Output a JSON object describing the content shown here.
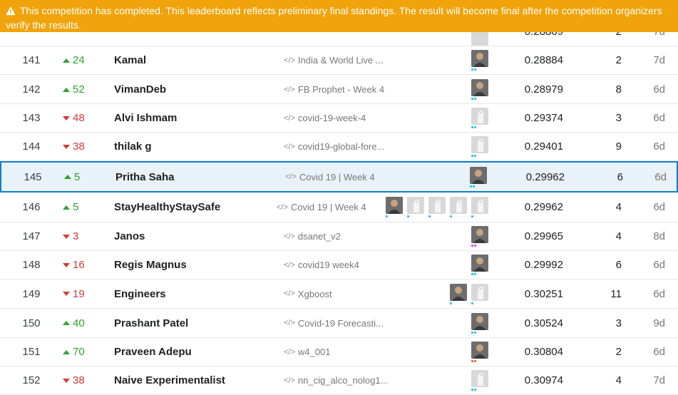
{
  "banner": {
    "icon": "warning-icon",
    "text": "This competition has completed. This leaderboard reflects preliminary final standings. The result will become final after the competition organizers verify the results.",
    "color": "#f0a30a"
  },
  "leaderboard": {
    "partial_row": {
      "score": "0.28869",
      "entries": "2",
      "last": "7d"
    },
    "rows": [
      {
        "rank": "141",
        "direction": "up",
        "change": "24",
        "team": "Kamal",
        "kernel": "India & World Live ...",
        "avatars": [
          "photo"
        ],
        "score": "0.28884",
        "entries": "2",
        "last": "7d",
        "me": false
      },
      {
        "rank": "142",
        "direction": "up",
        "change": "52",
        "team": "VimanDeb",
        "kernel": "FB Prophet - Week 4",
        "avatars": [
          "photo"
        ],
        "score": "0.28979",
        "entries": "8",
        "last": "6d",
        "me": false
      },
      {
        "rank": "143",
        "direction": "down",
        "change": "48",
        "team": "Alvi Ishmam",
        "kernel": "covid-19-week-4",
        "avatars": [
          "default"
        ],
        "score": "0.29374",
        "entries": "3",
        "last": "6d",
        "me": false
      },
      {
        "rank": "144",
        "direction": "down",
        "change": "38",
        "team": "thilak g",
        "kernel": "covid19-global-fore...",
        "avatars": [
          "default"
        ],
        "score": "0.29401",
        "entries": "9",
        "last": "6d",
        "me": false
      },
      {
        "rank": "145",
        "direction": "up",
        "change": "5",
        "team": "Pritha Saha",
        "kernel": "Covid 19 | Week 4",
        "avatars": [
          "photo"
        ],
        "score": "0.29962",
        "entries": "6",
        "last": "6d",
        "me": true
      },
      {
        "rank": "146",
        "direction": "up",
        "change": "5",
        "team": "StayHealthyStaySafe",
        "kernel": "Covid 19 | Week 4",
        "avatars": [
          "photo",
          "default",
          "default",
          "default",
          "default"
        ],
        "score": "0.29962",
        "entries": "4",
        "last": "6d",
        "me": false
      },
      {
        "rank": "147",
        "direction": "down",
        "change": "3",
        "team": "Janos",
        "kernel": "dsanet_v2",
        "avatars": [
          "photo"
        ],
        "score": "0.29965",
        "entries": "4",
        "last": "8d",
        "me": false
      },
      {
        "rank": "148",
        "direction": "down",
        "change": "16",
        "team": "Regis Magnus",
        "kernel": "covid19 week4",
        "avatars": [
          "photo"
        ],
        "score": "0.29992",
        "entries": "6",
        "last": "6d",
        "me": false
      },
      {
        "rank": "149",
        "direction": "down",
        "change": "19",
        "team": "Engineers",
        "kernel": "Xgboost",
        "avatars": [
          "photo",
          "default"
        ],
        "score": "0.30251",
        "entries": "11",
        "last": "6d",
        "me": false
      },
      {
        "rank": "150",
        "direction": "up",
        "change": "40",
        "team": "Prashant Patel",
        "kernel": "Covid-19 Forecasti...",
        "avatars": [
          "photo"
        ],
        "score": "0.30524",
        "entries": "3",
        "last": "9d",
        "me": false
      },
      {
        "rank": "151",
        "direction": "up",
        "change": "70",
        "team": "Praveen Adepu",
        "kernel": "w4_001",
        "avatars": [
          "photo"
        ],
        "score": "0.30804",
        "entries": "2",
        "last": "6d",
        "me": false
      },
      {
        "rank": "152",
        "direction": "down",
        "change": "38",
        "team": "Naive Experimentalist",
        "kernel": "nn_cig_alco_nolog1...",
        "avatars": [
          "default"
        ],
        "score": "0.30974",
        "entries": "4",
        "last": "7d",
        "me": false
      }
    ]
  },
  "colors": {
    "up": "#2fa32f",
    "down": "#d23a3a",
    "highlight_border": "#1280c8",
    "highlight_bg": "#e8f2f8",
    "tier_dots": [
      "#20beff",
      "#e040fb",
      "#f96517"
    ]
  }
}
